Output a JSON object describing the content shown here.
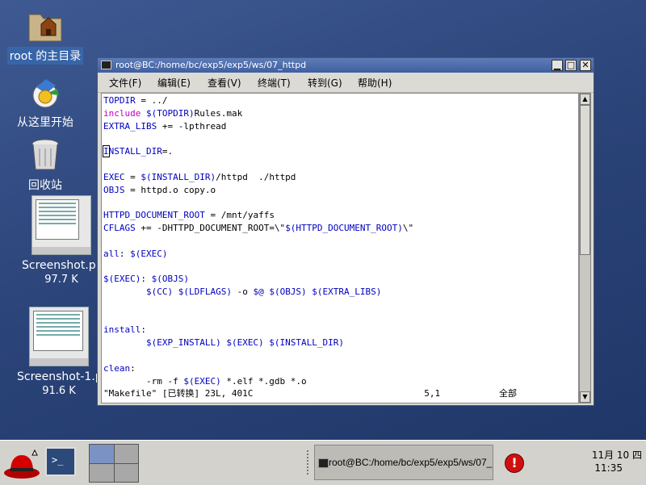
{
  "desktop": {
    "icons": [
      {
        "label": "root 的主目录",
        "icon": "home-folder-icon"
      },
      {
        "label": "从这里开始",
        "icon": "start-here-icon"
      },
      {
        "label": "回收站",
        "icon": "trash-icon"
      },
      {
        "label": "Screenshot.pn",
        "size": "97.7 K",
        "icon": "image-thumbnail"
      },
      {
        "label": "Screenshot-1.p",
        "size": "91.6 K",
        "icon": "image-thumbnail"
      }
    ]
  },
  "window": {
    "title": "root@BC:/home/bc/exp5/exp5/ws/07_httpd",
    "buttons": {
      "minimize": "▁",
      "maximize": "□",
      "close": "✕"
    },
    "menu": [
      "文件(F)",
      "编辑(E)",
      "查看(V)",
      "终端(T)",
      "转到(G)",
      "帮助(H)"
    ],
    "code_lines": [
      [
        {
          "t": "TOPDIR",
          "c": "#0000c0"
        },
        {
          "t": " = ../",
          "c": "#000"
        }
      ],
      [
        {
          "t": "include",
          "c": "#c000c0"
        },
        {
          "t": " $(TOPDIR)",
          "c": "#0000c0"
        },
        {
          "t": "Rules.mak",
          "c": "#000"
        }
      ],
      [
        {
          "t": "EXTRA_LIBS",
          "c": "#0000c0"
        },
        {
          "t": " += -lpthread",
          "c": "#000"
        }
      ],
      [],
      [
        {
          "t": "I",
          "c": "#0000c0"
        },
        {
          "t": "NSTALL_DIR",
          "c": "#0000c0"
        },
        {
          "t": "=.",
          "c": "#000"
        }
      ],
      [],
      [
        {
          "t": "EXEC",
          "c": "#0000c0"
        },
        {
          "t": " = ",
          "c": "#000"
        },
        {
          "t": "$(INSTALL_DIR)",
          "c": "#0000c0"
        },
        {
          "t": "/httpd  ./httpd",
          "c": "#000"
        }
      ],
      [
        {
          "t": "OBJS",
          "c": "#0000c0"
        },
        {
          "t": " = httpd.o copy.o",
          "c": "#000"
        }
      ],
      [],
      [
        {
          "t": "HTTPD_DOCUMENT_ROOT",
          "c": "#0000c0"
        },
        {
          "t": " = /mnt/yaffs",
          "c": "#000"
        }
      ],
      [
        {
          "t": "CFLAGS",
          "c": "#0000c0"
        },
        {
          "t": " += -DHTTPD_DOCUMENT_ROOT=\\\"",
          "c": "#000"
        },
        {
          "t": "$(HTTPD_DOCUMENT_ROOT)",
          "c": "#0000c0"
        },
        {
          "t": "\\\"",
          "c": "#000"
        }
      ],
      [],
      [
        {
          "t": "all",
          "c": "#0000c0"
        },
        {
          "t": ": ",
          "c": "#000"
        },
        {
          "t": "$(EXEC)",
          "c": "#0000c0"
        }
      ],
      [],
      [
        {
          "t": "$(EXEC)",
          "c": "#0000c0"
        },
        {
          "t": ": ",
          "c": "#000"
        },
        {
          "t": "$(OBJS)",
          "c": "#0000c0"
        }
      ],
      [
        {
          "t": "        ",
          "c": "#000"
        },
        {
          "t": "$(CC) $(LDFLAGS)",
          "c": "#0000c0"
        },
        {
          "t": " -o ",
          "c": "#000"
        },
        {
          "t": "$@ $(OBJS) $(EXTRA_LIBS)",
          "c": "#0000c0"
        }
      ],
      [],
      [],
      [
        {
          "t": "install",
          "c": "#0000c0"
        },
        {
          "t": ":",
          "c": "#000"
        }
      ],
      [
        {
          "t": "        ",
          "c": "#000"
        },
        {
          "t": "$(EXP_INSTALL) $(EXEC) $(INSTALL_DIR)",
          "c": "#0000c0"
        }
      ],
      [],
      [
        {
          "t": "clean",
          "c": "#0000c0"
        },
        {
          "t": ":",
          "c": "#000"
        }
      ],
      [
        {
          "t": "        -rm -f ",
          "c": "#000"
        },
        {
          "t": "$(EXEC)",
          "c": "#0000c0"
        },
        {
          "t": " *.elf *.gdb *.o",
          "c": "#000"
        }
      ]
    ],
    "status_line": "\"Makefile\" [已转换] 23L, 401C                                5,1           全部"
  },
  "taskbar": {
    "task_button": "root@BC:/home/bc/exp5/exp5/ws/07_",
    "clock_date": "11月 10 四",
    "clock_time": "11:35",
    "terminal_glyph": ">_",
    "alert_glyph": "!"
  }
}
